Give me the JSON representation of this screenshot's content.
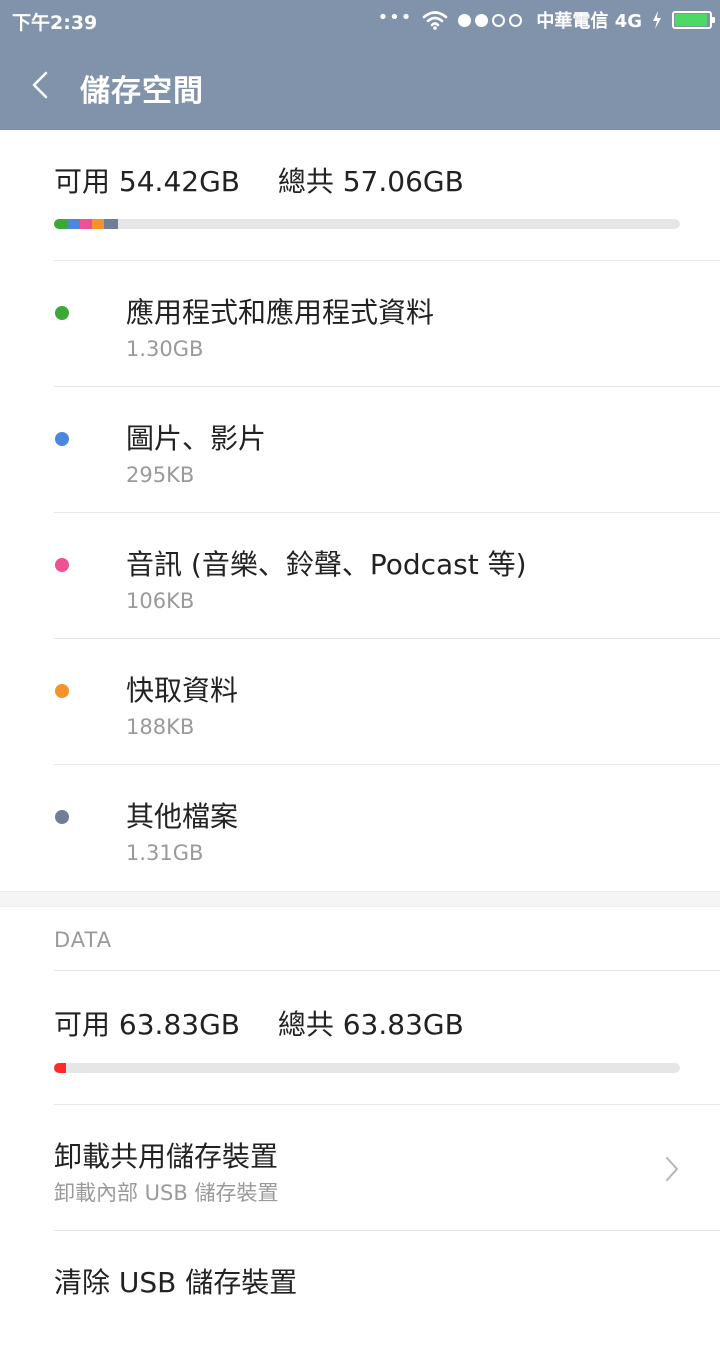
{
  "status_bar": {
    "time": "下午2:39",
    "more_dots": "•••",
    "carrier": "中華電信 4G",
    "signal_strength": "2 of 4",
    "battery_level": 0.95,
    "icons": [
      "wifi-icon",
      "signal-icon",
      "charging-icon",
      "battery-icon"
    ]
  },
  "header": {
    "title": "儲存空間",
    "back_icon": "chevron-left-icon",
    "background": "#8193ab"
  },
  "internal_storage": {
    "available_label": "可用",
    "available_value": "54.42GB",
    "total_label": "總共",
    "total_value": "57.06GB",
    "categories": [
      {
        "label": "應用程式和應用程式資料",
        "size": "1.30GB",
        "color": "#3aa935"
      },
      {
        "label": "圖片、影片",
        "size": "295KB",
        "color": "#4a88de"
      },
      {
        "label": "音訊 (音樂、鈴聲、Podcast 等)",
        "size": "106KB",
        "color": "#ef5192"
      },
      {
        "label": "快取資料",
        "size": "188KB",
        "color": "#f5922a"
      },
      {
        "label": "其他檔案",
        "size": "1.31GB",
        "color": "#707f95"
      }
    ]
  },
  "data_storage": {
    "section_header": "DATA",
    "available_label": "可用",
    "available_value": "63.83GB",
    "total_label": "總共",
    "total_value": "63.83GB",
    "bar_color": "#ff2a2a"
  },
  "actions": [
    {
      "title": "卸載共用儲存裝置",
      "subtitle": "卸載內部 USB 儲存裝置",
      "icon": "chevron-right-icon"
    },
    {
      "title": "清除 USB 儲存裝置"
    }
  ]
}
